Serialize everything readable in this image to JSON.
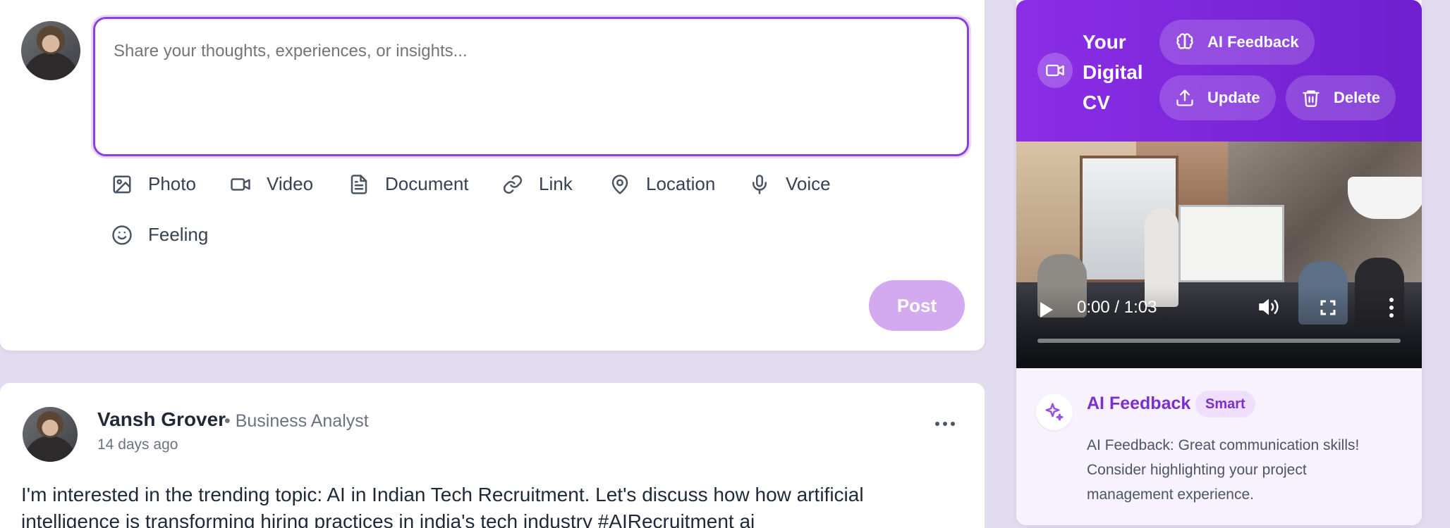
{
  "composer": {
    "placeholder": "Share your thoughts, experiences, or insights...",
    "tools": [
      {
        "label": "Photo",
        "icon": "image-icon"
      },
      {
        "label": "Video",
        "icon": "video-icon"
      },
      {
        "label": "Document",
        "icon": "document-icon"
      },
      {
        "label": "Link",
        "icon": "link-icon"
      },
      {
        "label": "Location",
        "icon": "map-pin-icon"
      },
      {
        "label": "Voice",
        "icon": "mic-icon"
      },
      {
        "label": "Feeling",
        "icon": "smile-icon"
      }
    ],
    "post_label": "Post"
  },
  "post": {
    "author": "Vansh Grover",
    "role": "• Business Analyst",
    "time": "14 days ago",
    "text": "I'm interested in the trending topic: AI in Indian Tech Recruitment. Let's discuss how how artificial intelligence is transforming hiring practices in india's tech industry #AIRecruitment ai"
  },
  "cv_panel": {
    "title": "Your Digital CV",
    "ai_feedback_label": "AI Feedback",
    "update_label": "Update",
    "delete_label": "Delete",
    "video": {
      "time": "0:00 / 1:03",
      "progress": 0.0
    },
    "feedback": {
      "title": "AI Feedback",
      "badge": "Smart",
      "text": "AI Feedback: Great communication skills! Consider highlighting your project management experience."
    }
  },
  "colors": {
    "accent": "#8b3fe0",
    "header_gradient_start": "#8b2ee6",
    "header_gradient_end": "#6f1fcf",
    "post_button": "#d3a9f0",
    "page_bg": "#f6f4fb"
  }
}
